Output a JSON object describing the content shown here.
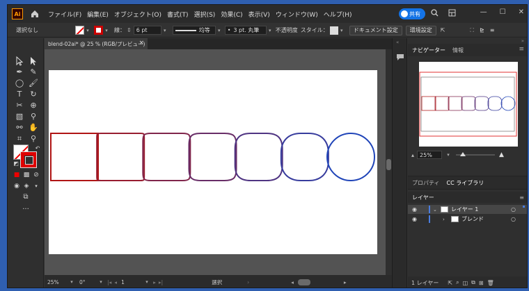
{
  "app": {
    "logo": "Ai"
  },
  "menubar": {
    "items": [
      "ファイル(F)",
      "編集(E)",
      "オブジェクト(O)",
      "書式(T)",
      "選択(S)",
      "効果(C)",
      "表示(V)",
      "ウィンドウ(W)",
      "ヘルプ(H)"
    ],
    "share_label": "共有"
  },
  "controlbar": {
    "selection_status": "選択なし",
    "stroke_label": "線：",
    "stroke_weight": "6 pt",
    "profile_label": "均等",
    "brush_label": "3 pt. 丸筆",
    "opacity_label": "不透明度",
    "style_label": "スタイル：",
    "doc_settings": "ドキュメント設定",
    "preferences": "環境設定"
  },
  "document": {
    "tab_title": "blend-02ai* @ 25 % (RGB/プレビュー)",
    "close": "×"
  },
  "statusbar": {
    "zoom": "25%",
    "rotation": "0°",
    "artboard_num": "1",
    "tool_name": "選択"
  },
  "navigator": {
    "tabs": [
      "ナビゲーター",
      "情報"
    ],
    "zoom": "25%"
  },
  "properties_tabs": [
    "プロパティ",
    "CC ライブラリ"
  ],
  "layers": {
    "title": "レイヤー",
    "rows": [
      {
        "name": "レイヤー 1"
      },
      {
        "name": "ブレンド"
      }
    ],
    "footer_count": "1 レイヤー"
  },
  "colors": {
    "blend_start": "#b01515",
    "blend_end": "#1f44b8",
    "accent": "#1473e6",
    "layer_highlight": "#4a7de0"
  },
  "icons": {
    "home": "home-icon",
    "search": "search-icon",
    "arrange": "arrange-documents-icon",
    "minimize": "minimize-icon",
    "maximize": "maximize-icon",
    "close": "close-icon"
  }
}
